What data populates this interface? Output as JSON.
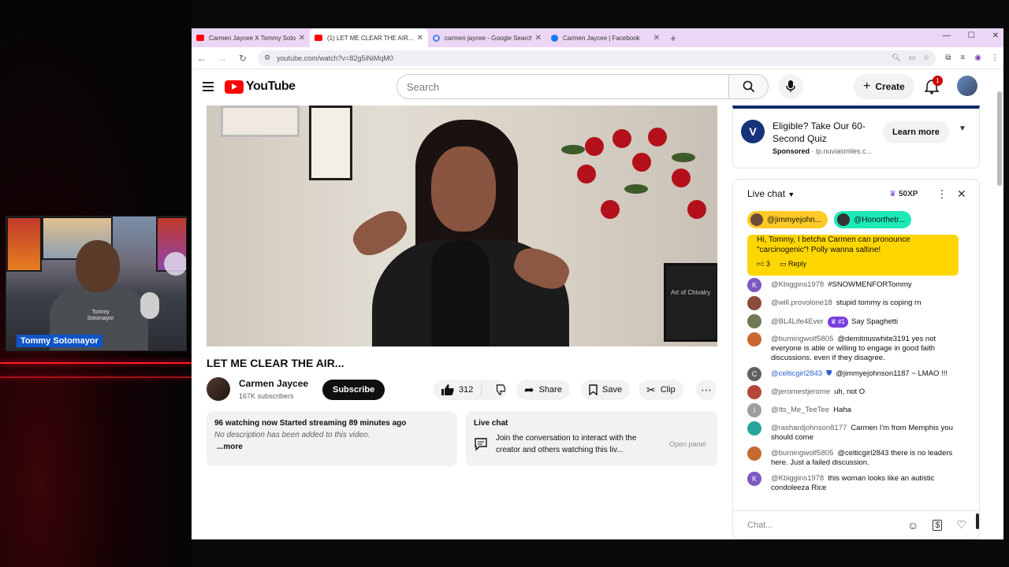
{
  "webcam": {
    "name": "Tommy Sotomayor",
    "shirt_text": "Tommy Sotomayor"
  },
  "browser": {
    "tabs": [
      {
        "title": "Carmen Jaycee X Tommy Sotom",
        "fav_color": "#ff0000"
      },
      {
        "title": "(1) LET ME CLEAR THE AIR... - Yo",
        "fav_color": "#ff0000"
      },
      {
        "title": "carmen jaycee - Google Search",
        "fav_color": "#4285f4"
      },
      {
        "title": "Carmen Jaycee | Facebook",
        "fav_color": "#1877f2"
      }
    ],
    "url": "youtube.com/watch?v=82g5iNiMqM0"
  },
  "youtube": {
    "logo_text": "YouTube",
    "search_placeholder": "Search",
    "create_label": "Create",
    "notif_count": "1"
  },
  "video": {
    "title": "LET ME CLEAR THE AIR...",
    "channel": "Carmen Jaycee",
    "subscribers": "167K subscribers",
    "subscribe_label": "Subscribe",
    "likes": "312",
    "share_label": "Share",
    "save_label": "Save",
    "clip_label": "Clip",
    "watching": "96 watching now  Started streaming 89 minutes ago",
    "description": "No description has been added to this video.",
    "more_label": "...more",
    "live_chat_title": "Live chat",
    "live_chat_msg": "Join the conversation to interact with the creator and others watching this liv...",
    "open_panel": "Open panel",
    "frame_text": "Art of Chivalry"
  },
  "ad": {
    "logo": "V",
    "title": "Eligible? Take Our 60-Second Quiz",
    "sponsored": "Sponsored",
    "domain": "lp.nuviasmiles.c...",
    "cta": "Learn more"
  },
  "chat": {
    "title": "Live chat",
    "xp": "50XP",
    "tickers": [
      {
        "name": "@jimmyejohn...",
        "color": "#ffca28"
      },
      {
        "name": "@Honorthetr...",
        "color": "#1de9b6"
      }
    ],
    "superchat": {
      "text": "Hi, Tommy, I betcha Carmen can pronounce \"carcinogenic\"! Polly wanna saltine!",
      "likes": "3",
      "reply": "Reply"
    },
    "messages": [
      {
        "author": "@Kbiggins1978",
        "text": "#SNOWMENFORTommy",
        "avatar": "K",
        "avatar_color": "#7e57c2"
      },
      {
        "author": "@will.provolone18",
        "text": "stupid tommy is coping rn",
        "avatar": "",
        "avatar_color": "#8d4b3c"
      },
      {
        "author": "@BL4Life4Ever",
        "badge": "#1",
        "text": "Say Spaghetti",
        "avatar": "",
        "avatar_color": "#6d7a55"
      },
      {
        "author": "@burningwolf5805",
        "text": "@demitriuswhite3191 yes not everyone is able or willing to engage in good faith discussions. even if they disagree.",
        "avatar": "",
        "avatar_color": "#c7692f"
      },
      {
        "author": "@celticgirl2843",
        "mod": true,
        "text": "@jimmyejohnson1187 ~ LMAO !!!",
        "avatar": "C",
        "avatar_color": "#616161"
      },
      {
        "author": "@jeromestjerome",
        "text": "uh, not O",
        "avatar": "",
        "avatar_color": "#b4463a"
      },
      {
        "author": "@Its_Me_TeeTee",
        "text": "Haha",
        "avatar": "I",
        "avatar_color": "#9e9e9e"
      },
      {
        "author": "@rashardjohnson8177",
        "text": "Carmen I'm from Memphis you should come",
        "avatar": "",
        "avatar_color": "#26a69a"
      },
      {
        "author": "@burningwolf5805",
        "text": "@celticgirl2843 there is no leaders here. Just a failed discussion.",
        "avatar": "",
        "avatar_color": "#c7692f"
      },
      {
        "author": "@Kbiggins1978",
        "text": "this woman looks like an autistic condoleeza Rice",
        "avatar": "K",
        "avatar_color": "#7e57c2"
      }
    ],
    "input_placeholder": "Chat..."
  }
}
